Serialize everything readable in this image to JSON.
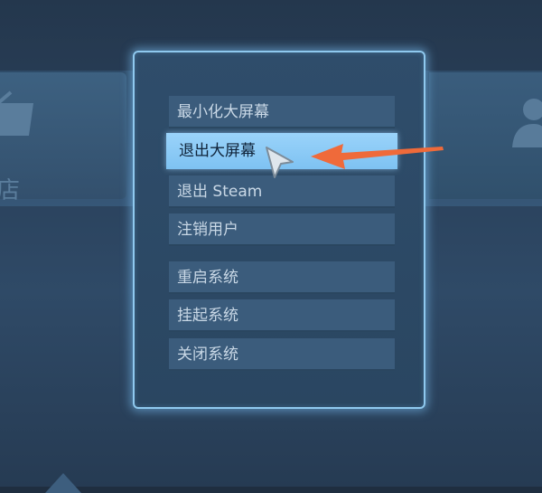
{
  "menu": {
    "items": [
      "最小化大屏幕",
      "退出大屏幕",
      "退出 Steam",
      "注销用户",
      "重启系统",
      "挂起系统",
      "关闭系统"
    ],
    "selected_index": 1
  },
  "background": {
    "store_label": "店"
  },
  "colors": {
    "dialog_border": "#8fc9ef",
    "item_bg": "#3b5c7c",
    "selected_bg": "#8ccbf6",
    "arrow": "#ef6a3a"
  },
  "icons": {
    "pointer": "mouse-pointer-icon",
    "annotation": "arrow-icon",
    "store": "store-basket-icon",
    "friends": "person-icon"
  }
}
